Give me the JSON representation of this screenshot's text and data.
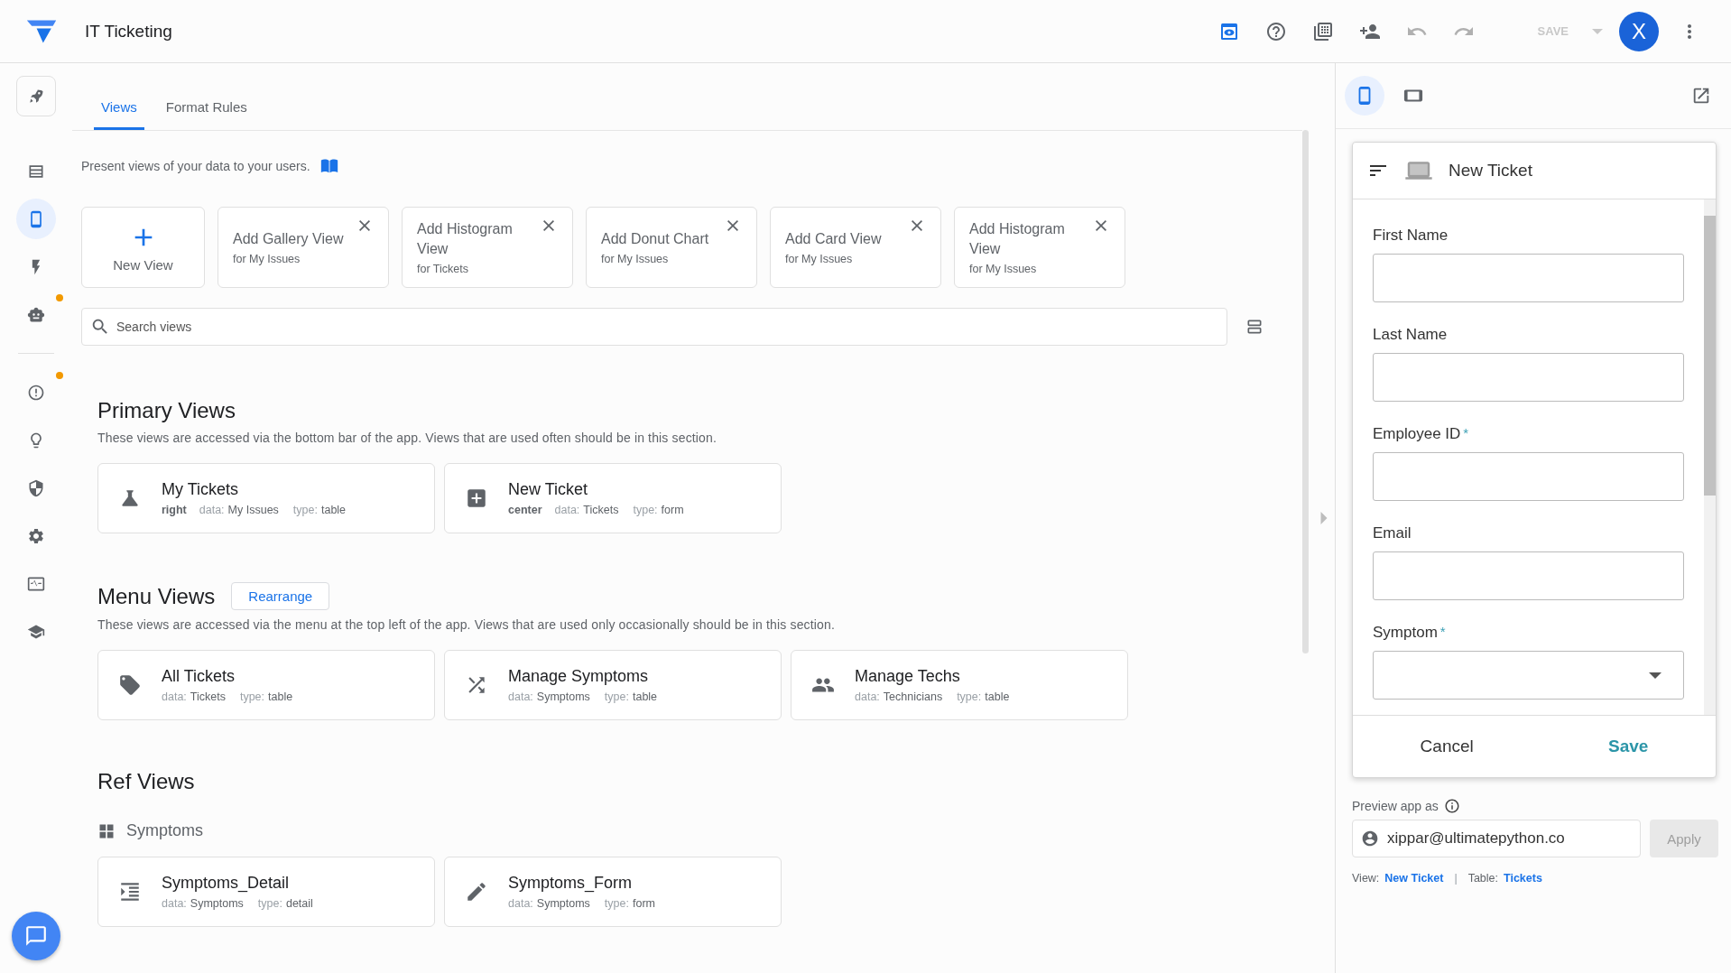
{
  "app": {
    "title": "IT Ticketing"
  },
  "toolbar": [
    {
      "kind": "preview",
      "disabled": false
    },
    {
      "kind": "help",
      "disabled": false
    },
    {
      "kind": "gallery",
      "disabled": false
    },
    {
      "kind": "add-person",
      "disabled": false
    },
    {
      "kind": "undo",
      "disabled": true
    },
    {
      "kind": "redo",
      "disabled": true
    }
  ],
  "save": {
    "label": "SAVE",
    "disabled": true
  },
  "avatar": {
    "initial": "X"
  },
  "sidebar": {
    "groups": [
      [
        {
          "kind": "rocket",
          "selected": false,
          "dot": false
        },
        {
          "kind": "data",
          "selected": false,
          "dot": false
        },
        {
          "kind": "phone",
          "selected": true,
          "dot": false
        },
        {
          "kind": "bolt",
          "selected": false,
          "dot": false
        },
        {
          "kind": "robot",
          "selected": false,
          "dot": true
        }
      ],
      [
        {
          "kind": "alert",
          "selected": false,
          "dot": true
        },
        {
          "kind": "bulb",
          "selected": false,
          "dot": false
        },
        {
          "kind": "shield",
          "selected": false,
          "dot": false
        },
        {
          "kind": "gear",
          "selected": false,
          "dot": false
        },
        {
          "kind": "monitor",
          "selected": false,
          "dot": false
        },
        {
          "kind": "school",
          "selected": false,
          "dot": false
        }
      ]
    ]
  },
  "tabs": [
    {
      "label": "Views",
      "selected": true
    },
    {
      "label": "Format Rules",
      "selected": false
    }
  ],
  "intro": "Present views of your data to your users.",
  "new_view": "New View",
  "suggestions": [
    {
      "title": "Add Gallery View",
      "subtitle": "for My Issues"
    },
    {
      "title": "Add Histogram View",
      "subtitle": "for Tickets"
    },
    {
      "title": "Add Donut Chart",
      "subtitle": "for My Issues"
    },
    {
      "title": "Add Card View",
      "subtitle": "for My Issues"
    },
    {
      "title": "Add Histogram View",
      "subtitle": "for My Issues"
    }
  ],
  "search": {
    "placeholder": "Search views"
  },
  "sections": [
    {
      "title": "Primary Views",
      "description": "These views are accessed via the bottom bar of the app. Views that are used often should be in this section.",
      "views": [
        {
          "kind": "flask",
          "name": "My Tickets",
          "position": "right",
          "data_label": "data:",
          "data": "My Issues",
          "type_label": "type:",
          "type": "table"
        },
        {
          "kind": "plus-box",
          "name": "New Ticket",
          "position": "center",
          "data_label": "data:",
          "data": "Tickets",
          "type_label": "type:",
          "type": "form"
        }
      ]
    },
    {
      "title": "Menu Views",
      "button": "Rearrange",
      "description": "These views are accessed via the menu at the top left of the app. Views that are used only occasionally should be in this section.",
      "views": [
        {
          "kind": "tag",
          "name": "All Tickets",
          "data_label": "data:",
          "data": "Tickets",
          "type_label": "type:",
          "type": "table"
        },
        {
          "kind": "shuffle",
          "name": "Manage Symptoms",
          "data_label": "data:",
          "data": "Symptoms",
          "type_label": "type:",
          "type": "table"
        },
        {
          "kind": "people",
          "name": "Manage Techs",
          "data_label": "data:",
          "data": "Technicians",
          "type_label": "type:",
          "type": "table"
        }
      ]
    },
    {
      "title": "Ref Views",
      "subheading": "Symptoms",
      "views": [
        {
          "kind": "indent",
          "name": "Symptoms_Detail",
          "data_label": "data:",
          "data": "Symptoms",
          "type_label": "type:",
          "type": "detail"
        },
        {
          "kind": "pencil",
          "name": "Symptoms_Form",
          "data_label": "data:",
          "data": "Symptoms",
          "type_label": "type:",
          "type": "form"
        }
      ]
    }
  ],
  "preview": {
    "devices": [
      {
        "kind": "phone",
        "selected": true
      },
      {
        "kind": "tablet",
        "selected": false
      }
    ],
    "form_title": "New Ticket",
    "required_mark": "*",
    "fields": [
      {
        "label": "First Name",
        "required": false,
        "kind": "text"
      },
      {
        "label": "Last Name",
        "required": false,
        "kind": "text"
      },
      {
        "label": "Employee ID",
        "required": true,
        "kind": "text"
      },
      {
        "label": "Email",
        "required": false,
        "kind": "text"
      },
      {
        "label": "Symptom",
        "required": true,
        "kind": "dropdown"
      }
    ],
    "cancel": "Cancel",
    "save": "Save",
    "preview_as_label": "Preview app as",
    "email": "xippar@ultimatepython.co",
    "apply": {
      "label": "Apply",
      "disabled": true
    },
    "view_label": "View:",
    "view": "New Ticket",
    "separator": "|",
    "table_label": "Table:",
    "table": "Tickets"
  }
}
